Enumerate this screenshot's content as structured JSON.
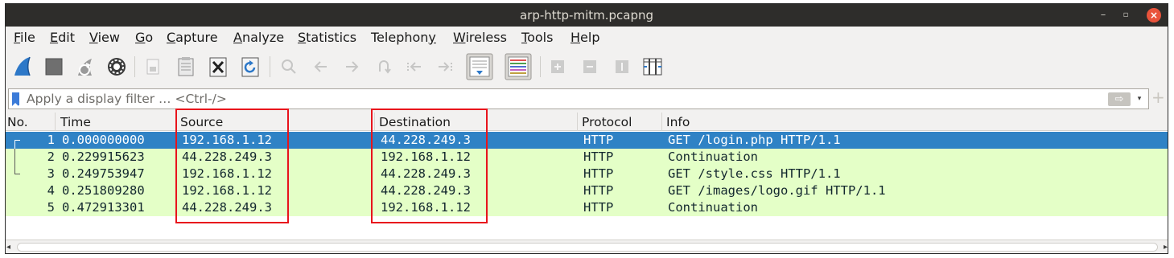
{
  "window": {
    "title": "arp-http-mitm.pcapng",
    "controls": {
      "minimize": "–",
      "maximize": "▫",
      "close": "×"
    }
  },
  "menu": [
    {
      "pre": "",
      "ul": "F",
      "post": "ile"
    },
    {
      "pre": "",
      "ul": "E",
      "post": "dit"
    },
    {
      "pre": "",
      "ul": "V",
      "post": "iew"
    },
    {
      "pre": "",
      "ul": "G",
      "post": "o"
    },
    {
      "pre": "",
      "ul": "C",
      "post": "apture"
    },
    {
      "pre": "",
      "ul": "A",
      "post": "nalyze"
    },
    {
      "pre": "",
      "ul": "S",
      "post": "tatistics"
    },
    {
      "pre": "Telephon",
      "ul": "y",
      "post": ""
    },
    {
      "pre": "",
      "ul": "W",
      "post": "ireless"
    },
    {
      "pre": "",
      "ul": "T",
      "post": "ools"
    },
    {
      "pre": "",
      "ul": "H",
      "post": "elp"
    }
  ],
  "toolbar": {
    "icons": [
      "start-capture-icon",
      "stop-capture-icon",
      "restart-capture-icon",
      "capture-options-icon",
      "open-file-icon",
      "save-file-icon",
      "close-file-icon",
      "reload-file-icon",
      "find-packet-icon",
      "go-back-icon",
      "go-forward-icon",
      "go-to-packet-icon",
      "first-packet-icon",
      "last-packet-icon",
      "auto-scroll-icon",
      "colorize-icon",
      "zoom-in-icon",
      "zoom-out-icon",
      "normal-size-icon",
      "resize-columns-icon"
    ]
  },
  "filter": {
    "placeholder": "Apply a display filter … <Ctrl-/>",
    "apply_label": "⇨",
    "dropdown_label": "▾",
    "add_label": "+"
  },
  "columns": [
    "No.",
    "Time",
    "Source",
    "Destination",
    "Protocol",
    "Info"
  ],
  "packets": [
    {
      "no": "1",
      "time": "0.000000000",
      "source": "192.168.1.12",
      "destination": "44.228.249.3",
      "protocol": "HTTP",
      "info": "GET /login.php HTTP/1.1"
    },
    {
      "no": "2",
      "time": "0.229915623",
      "source": "44.228.249.3",
      "destination": "192.168.1.12",
      "protocol": "HTTP",
      "info": "Continuation"
    },
    {
      "no": "3",
      "time": "0.249753947",
      "source": "192.168.1.12",
      "destination": "44.228.249.3",
      "protocol": "HTTP",
      "info": "GET /style.css HTTP/1.1"
    },
    {
      "no": "4",
      "time": "0.251809280",
      "source": "192.168.1.12",
      "destination": "44.228.249.3",
      "protocol": "HTTP",
      "info": "GET /images/logo.gif HTTP/1.1"
    },
    {
      "no": "5",
      "time": "0.472913301",
      "source": "44.228.249.3",
      "destination": "192.168.1.12",
      "protocol": "HTTP",
      "info": "Continuation"
    }
  ],
  "selected_packet": "1",
  "colors": {
    "selected_row": "#2f82c5",
    "http_row": "#e4ffc7",
    "annotation": "#e8141c",
    "title_bar": "#2e2d2b"
  }
}
